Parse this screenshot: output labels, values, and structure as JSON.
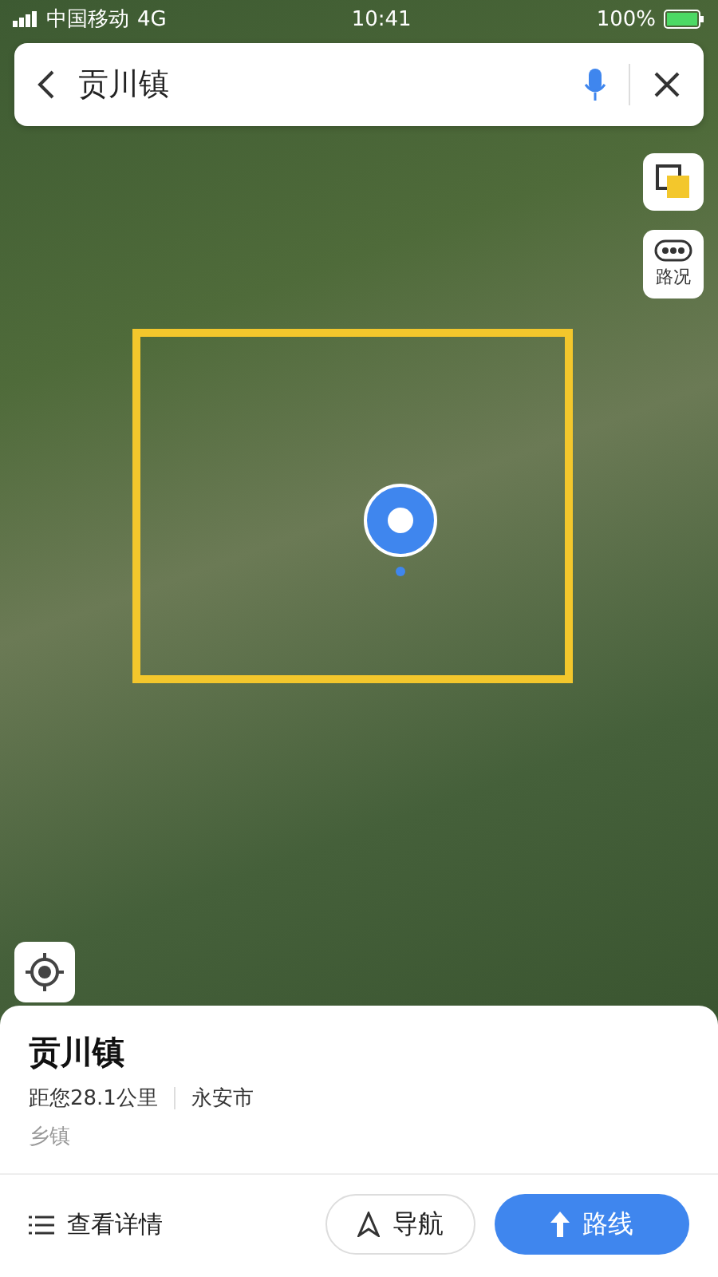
{
  "status_bar": {
    "carrier": "中国移动",
    "network": "4G",
    "time": "10:41",
    "battery": "100%"
  },
  "search": {
    "value": "贡川镇"
  },
  "map_controls": {
    "traffic_label": "路况"
  },
  "place": {
    "name": "贡川镇",
    "distance": "距您28.1公里",
    "city": "永安市",
    "category": "乡镇"
  },
  "actions": {
    "details": "查看详情",
    "navigate": "导航",
    "route": "路线"
  }
}
